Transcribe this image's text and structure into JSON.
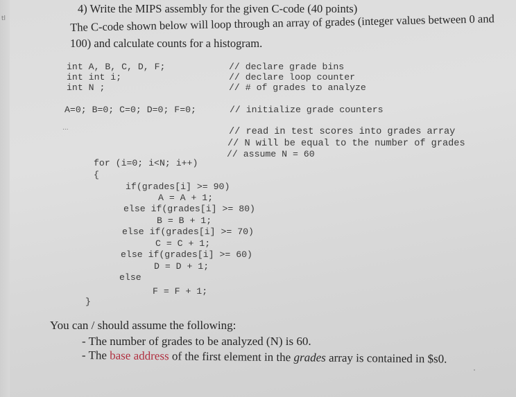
{
  "edge_text": "tl",
  "question": {
    "title": "4) Write the MIPS assembly for the given C-code (40 points)",
    "intro_line1": "The C-code shown below will loop through an array of grades (integer values between 0 and",
    "intro_line2": "100) and calculate counts for a histogram."
  },
  "code": {
    "declarations": [
      {
        "code": "int A, B, C, D, F;",
        "comment": "// declare grade bins"
      },
      {
        "code": "int int i;",
        "comment": "// declare loop counter"
      },
      {
        "code": "int N ;",
        "comment": "// # of grades to analyze"
      }
    ],
    "init": {
      "code": "A=0; B=0; C=0; D=0; F=0;",
      "comment": "// initialize grade counters"
    },
    "ellipsis": "...",
    "read_comments": [
      "// read in test scores into grades array",
      "// N will be equal to the number of grades",
      "// assume N = 60"
    ],
    "loop_lines": [
      "for (i=0; i<N; i++)",
      "{",
      "if(grades[i] >= 90)",
      "A = A + 1;",
      "else if(grades[i] >= 80)",
      "B = B + 1;",
      "else if(grades[i] >= 70)",
      "C = C + 1;",
      "else if(grades[i] >= 60)",
      "D = D + 1;",
      "else",
      "F = F + 1;",
      "}"
    ]
  },
  "assumptions": {
    "heading": "You can / should assume the following:",
    "item1": "- The number of grades to be analyzed (N) is 60.",
    "item2_prefix": "- The ",
    "item2_highlight": "base address",
    "item2_mid": " of the first element in the ",
    "item2_italic": "grades",
    "item2_suffix": " array is contained in $s0.",
    "highlight_color": "#b03040"
  }
}
